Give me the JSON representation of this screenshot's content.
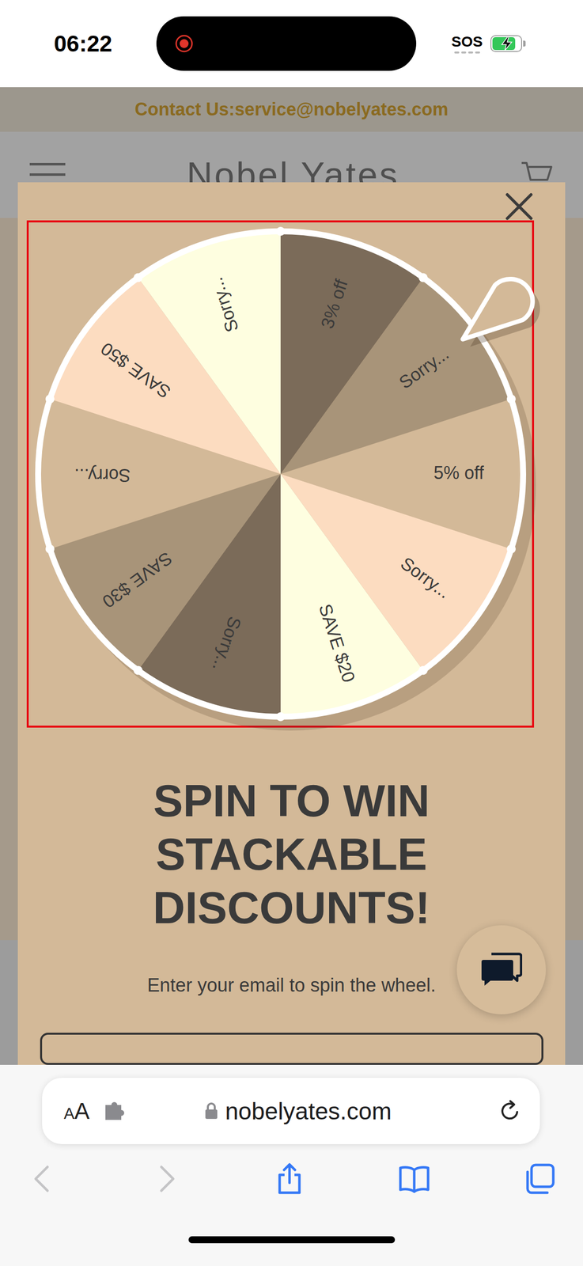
{
  "status_bar": {
    "time": "06:22",
    "carrier": "SOS",
    "screen_recording": true,
    "charging": true,
    "battery_level": 0.8
  },
  "announcement": {
    "text": "Contact Us:service@nobelyates.com"
  },
  "header": {
    "brand": "Nobel Yates"
  },
  "popup": {
    "wheel": {
      "segments": [
        {
          "label": "3% off",
          "color": "#7b6b59"
        },
        {
          "label": "Sorry...",
          "color": "#a89479"
        },
        {
          "label": "5% off",
          "color": "#d3b998"
        },
        {
          "label": "Sorry...",
          "color": "#fcdcc0"
        },
        {
          "label": "SAVE $20",
          "color": "#fefee0"
        },
        {
          "label": "Sorry...",
          "color": "#7b6b59"
        },
        {
          "label": "SAVE $30",
          "color": "#a89479"
        },
        {
          "label": "Sorry...",
          "color": "#d3b998"
        },
        {
          "label": "SAVE $50",
          "color": "#fcdcc0"
        },
        {
          "label": "Sorry...",
          "color": "#fefee0"
        }
      ]
    },
    "title_lines": [
      "SPIN TO WIN",
      "STACKABLE",
      "DISCOUNTS!"
    ],
    "subtitle": "Enter your email to spin the wheel."
  },
  "browser": {
    "text_size_button": "AA",
    "url": "nobelyates.com",
    "back_enabled": false,
    "forward_enabled": false
  }
}
